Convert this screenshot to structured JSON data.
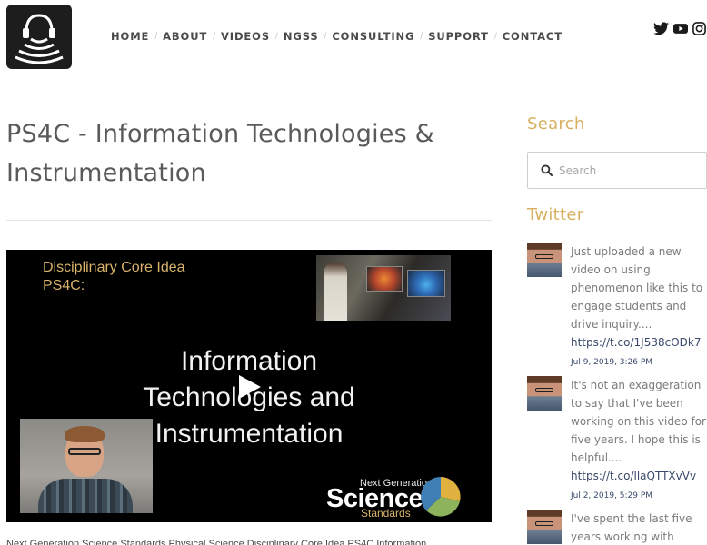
{
  "header": {
    "logo_icon": "headphones-soundwave-logo-icon",
    "nav": [
      {
        "label": "HOME"
      },
      {
        "label": "ABOUT"
      },
      {
        "label": "VIDEOS"
      },
      {
        "label": "NGSS"
      },
      {
        "label": "CONSULTING"
      },
      {
        "label": "SUPPORT"
      },
      {
        "label": "CONTACT"
      }
    ],
    "social_icons": [
      "twitter-icon",
      "youtube-icon",
      "instagram-icon"
    ]
  },
  "main": {
    "title": "PS4C - Information Technologies & Instrumentation",
    "video": {
      "kicker": "Disciplinary Core Idea PS4C:",
      "title": "Information Technologies and Instrumentation",
      "ngss_kicker": "Next Generation",
      "ngss_big": "Science",
      "ngss_small": "Standards",
      "play_icon": "play-icon"
    },
    "caption_partial": "Next Generation Science Standards Physical Science Disciplinary Core Idea PS4C Information"
  },
  "sidebar": {
    "search": {
      "title": "Search",
      "placeholder": "Search",
      "icon": "search-icon"
    },
    "twitter": {
      "title": "Twitter",
      "tweets": [
        {
          "text": "Just uploaded a new video on using phenomenon like this to engage students and drive inquiry....",
          "link": "https://t.co/1J538cODk7",
          "date": "Jul 9, 2019, 3:26 PM"
        },
        {
          "text": "It's not an exaggeration to say that I've been working on this video for five years. I hope this is helpful....",
          "link": "https://t.co/llaQTTXvVv",
          "date": "Jul 2, 2019, 5:29 PM"
        },
        {
          "text": "I've spent the last five years working with",
          "link": "",
          "date": ""
        }
      ]
    }
  },
  "colors": {
    "accent_gold": "#d8b060",
    "link_navy": "#3b4a6b",
    "nav_text": "#4a4a4a"
  }
}
